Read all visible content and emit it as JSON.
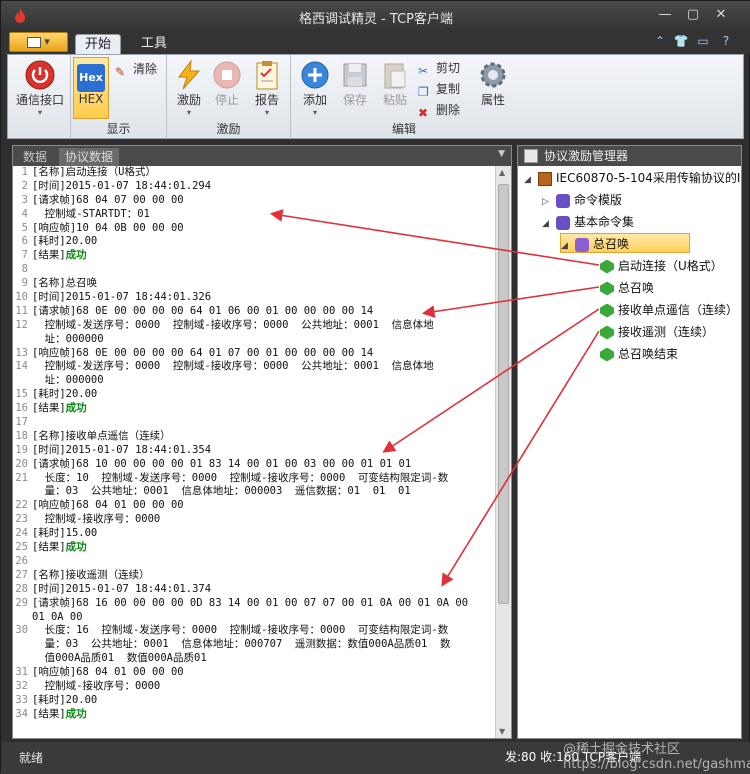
{
  "window": {
    "title": "格西调试精灵 - TCP客户端"
  },
  "file_button": {
    "label": "▾"
  },
  "tabs": [
    {
      "label": "开始"
    },
    {
      "label": "工具"
    }
  ],
  "ribbon": {
    "comm": {
      "label": "通信接口"
    },
    "display": {
      "hex_label": "HEX",
      "hex_icon_text": "Hex",
      "clear_label": "清除",
      "group_label": "显示"
    },
    "excite": {
      "excite_label": "激励",
      "stop_label": "停止",
      "report_label": "报告",
      "group_label": "激励"
    },
    "edit": {
      "add_label": "添加",
      "save_label": "保存",
      "paste_label": "粘贴",
      "cut_label": "剪切",
      "copy_label": "复制",
      "delete_label": "删除",
      "props_label": "属性",
      "group_label": "编辑"
    }
  },
  "left_panel": {
    "tabs": [
      {
        "label": "数据"
      },
      {
        "label": "协议数据"
      }
    ],
    "lines": [
      {
        "n": "1",
        "text": "[名称]启动连接（U格式）",
        "ok": ""
      },
      {
        "n": "2",
        "text": "[时间]2015-01-07 18:44:01.294",
        "ok": ""
      },
      {
        "n": "3",
        "text": "[请求帧]68 04 07 00 00 00",
        "ok": ""
      },
      {
        "n": "4",
        "text": "  控制域-STARTDT：01",
        "ok": ""
      },
      {
        "n": "5",
        "text": "[响应帧]10 04 0B 00 00 00",
        "ok": ""
      },
      {
        "n": "6",
        "text": "[耗时]20.00",
        "ok": ""
      },
      {
        "n": "7",
        "text": "[结果]",
        "ok": "成功"
      },
      {
        "n": "8",
        "text": "",
        "ok": ""
      },
      {
        "n": "9",
        "text": "[名称]总召唤",
        "ok": ""
      },
      {
        "n": "10",
        "text": "[时间]2015-01-07 18:44:01.326",
        "ok": ""
      },
      {
        "n": "11",
        "text": "[请求帧]68 0E 00 00 00 00 64 01 06 00 01 00 00 00 00 14",
        "ok": ""
      },
      {
        "n": "12",
        "text": "  控制域-发送序号：0000  控制域-接收序号：0000  公共地址：0001  信息体地",
        "ok": ""
      },
      {
        "n": "",
        "text": "  址：000000",
        "ok": ""
      },
      {
        "n": "13",
        "text": "[响应帧]68 0E 00 00 00 00 64 01 07 00 01 00 00 00 00 14",
        "ok": ""
      },
      {
        "n": "14",
        "text": "  控制域-发送序号：0000  控制域-接收序号：0000  公共地址：0001  信息体地",
        "ok": ""
      },
      {
        "n": "",
        "text": "  址：000000",
        "ok": ""
      },
      {
        "n": "15",
        "text": "[耗时]20.00",
        "ok": ""
      },
      {
        "n": "16",
        "text": "[结果]",
        "ok": "成功"
      },
      {
        "n": "17",
        "text": "",
        "ok": ""
      },
      {
        "n": "18",
        "text": "[名称]接收单点遥信（连续）",
        "ok": ""
      },
      {
        "n": "19",
        "text": "[时间]2015-01-07 18:44:01.354",
        "ok": ""
      },
      {
        "n": "20",
        "text": "[请求帧]68 10 00 00 00 00 01 83 14 00 01 00 03 00 00 01 01 01",
        "ok": ""
      },
      {
        "n": "21",
        "text": "  长度：10  控制域-发送序号：0000  控制域-接收序号：0000  可变结构限定词-数",
        "ok": ""
      },
      {
        "n": "",
        "text": "  量：03  公共地址：0001  信息体地址：000003  遥信数据：01  01  01",
        "ok": ""
      },
      {
        "n": "22",
        "text": "[响应帧]68 04 01 00 00 00",
        "ok": ""
      },
      {
        "n": "23",
        "text": "  控制域-接收序号：0000",
        "ok": ""
      },
      {
        "n": "24",
        "text": "[耗时]15.00",
        "ok": ""
      },
      {
        "n": "25",
        "text": "[结果]",
        "ok": "成功"
      },
      {
        "n": "26",
        "text": "",
        "ok": ""
      },
      {
        "n": "27",
        "text": "[名称]接收遥测（连续）",
        "ok": ""
      },
      {
        "n": "28",
        "text": "[时间]2015-01-07 18:44:01.374",
        "ok": ""
      },
      {
        "n": "29",
        "text": "[请求帧]68 16 00 00 00 00 0D 83 14 00 01 00 07 07 00 01 0A 00 01 0A 00",
        "ok": ""
      },
      {
        "n": "",
        "text": "01 0A 00",
        "ok": ""
      },
      {
        "n": "30",
        "text": "  长度：16  控制域-发送序号：0000  控制域-接收序号：0000  可变结构限定词-数",
        "ok": ""
      },
      {
        "n": "",
        "text": "  量：03  公共地址：0001  信息体地址：000707  遥测数据：数值000A品质01  数",
        "ok": ""
      },
      {
        "n": "",
        "text": "  值000A品质01  数值000A品质01",
        "ok": ""
      },
      {
        "n": "31",
        "text": "[响应帧]68 04 01 00 00 00",
        "ok": ""
      },
      {
        "n": "32",
        "text": "  控制域-接收序号：0000",
        "ok": ""
      },
      {
        "n": "33",
        "text": "[耗时]20.00",
        "ok": ""
      },
      {
        "n": "34",
        "text": "[结果]",
        "ok": "成功"
      }
    ]
  },
  "right_panel": {
    "title": "协议激励管理器",
    "tree": {
      "root": "IEC60870-5-104采用传输协议的I",
      "templates": "命令模版",
      "basic": "基本命令集",
      "general": "总召唤",
      "children": [
        "启动连接（U格式）",
        "总召唤",
        "接收单点遥信（连续）",
        "接收遥测（连续）",
        "总召唤结束"
      ]
    }
  },
  "status": {
    "text": "就绪",
    "right": "发:80  收:160   TCP客户端"
  },
  "watermark": "@稀土掘金技术社区  https://blog.csdn.net/gashmaster",
  "colors": {
    "accent": "#f0b020",
    "ok_green": "#0a8a16",
    "arrow_red": "#e0303a"
  }
}
